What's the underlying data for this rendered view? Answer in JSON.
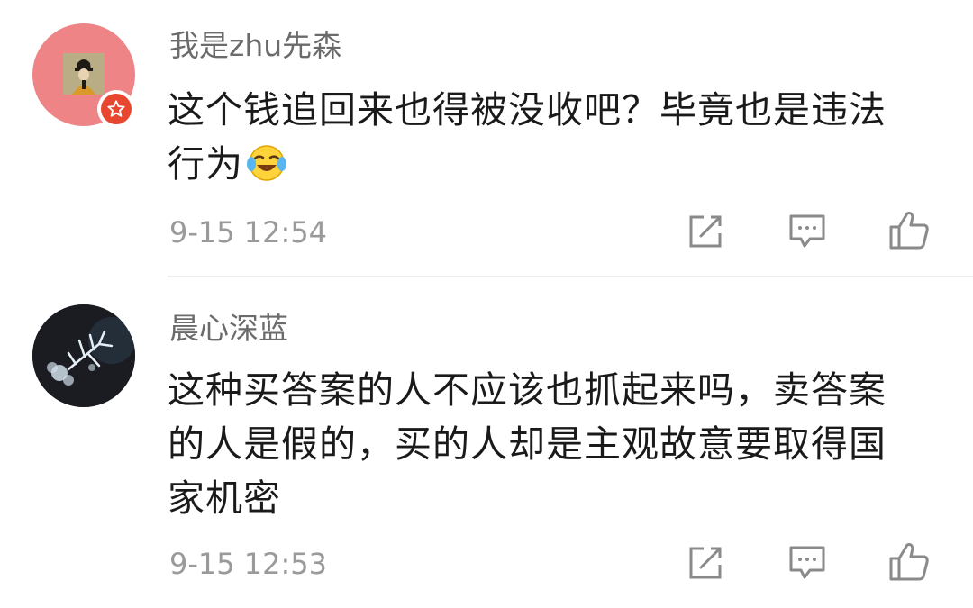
{
  "comments": [
    {
      "username": "我是zhu先森",
      "text_line1": "这个钱追回来也得被没收吧？毕竟也是违法",
      "text_line2": "行为",
      "emoji": "laugh-cry-emoji",
      "time": "9-15 12:54",
      "badge": "red-star-badge",
      "avatar_bg": "#ee8486"
    },
    {
      "username": "晨心深蓝",
      "text_line1": "这种买答案的人不应该也抓起来吗，卖答案",
      "text_line2": "的人是假的，买的人却是主观故意要取得国",
      "text_line3": "家机密",
      "time": "9-15 12:53",
      "avatar_bg": "#1b1c22"
    }
  ],
  "actions": {
    "forward_icon": "share-edit-icon",
    "comment_icon": "comment-bubble-icon",
    "like_icon": "thumbs-up-icon"
  },
  "colors": {
    "username": "#6b6b6b",
    "text": "#1a1a1a",
    "time": "#9a9a9a",
    "icon": "#8a8a8a",
    "badge": "#e6472e"
  }
}
